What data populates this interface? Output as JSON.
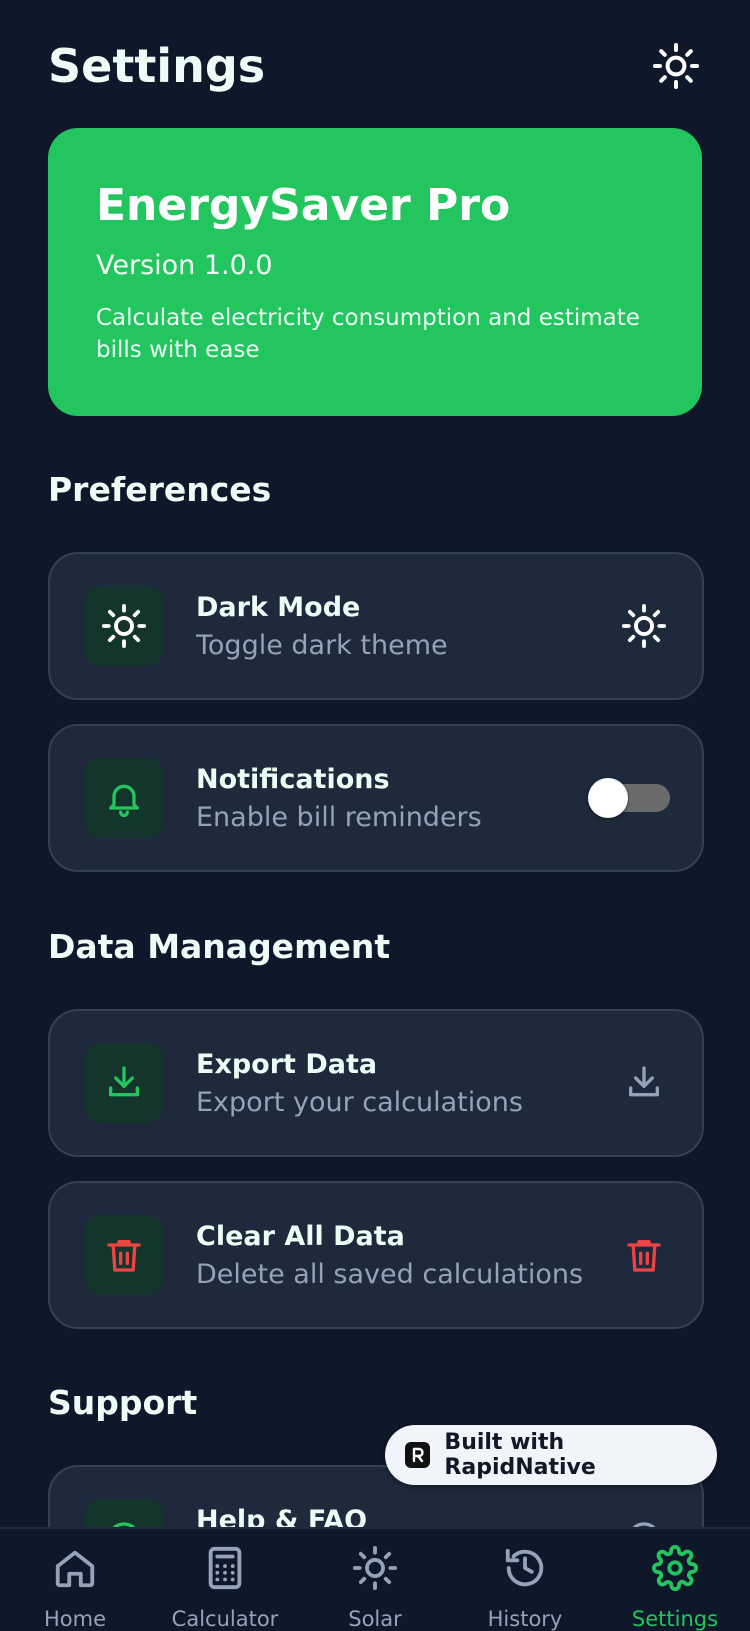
{
  "header": {
    "title": "Settings",
    "theme_icon": "sun-icon"
  },
  "hero": {
    "title": "EnergySaver Pro",
    "version": "Version 1.0.0",
    "description": "Calculate electricity consumption and estimate bills with ease"
  },
  "sections": {
    "preferences": "Preferences",
    "data_management": "Data Management",
    "support": "Support"
  },
  "preferences": {
    "dark_mode": {
      "title": "Dark Mode",
      "subtitle": "Toggle dark theme",
      "icon": "sun-icon"
    },
    "notifications": {
      "title": "Notifications",
      "subtitle": "Enable bill reminders",
      "icon": "bell-icon",
      "enabled": false
    }
  },
  "data_management": {
    "export": {
      "title": "Export Data",
      "subtitle": "Export your calculations",
      "icon": "download-icon"
    },
    "clear": {
      "title": "Clear All Data",
      "subtitle": "Delete all saved calculations",
      "icon": "trash-icon"
    }
  },
  "support": {
    "help": {
      "title": "Help & FAQ",
      "icon": "help-icon"
    }
  },
  "badge": {
    "text": "Built with RapidNative"
  },
  "tabs": [
    {
      "label": "Home",
      "icon": "home-icon",
      "active": false
    },
    {
      "label": "Calculator",
      "icon": "calculator-icon",
      "active": false
    },
    {
      "label": "Solar",
      "icon": "sun-icon",
      "active": false
    },
    {
      "label": "History",
      "icon": "history-icon",
      "active": false
    },
    {
      "label": "Settings",
      "icon": "gear-icon",
      "active": true
    }
  ],
  "colors": {
    "background": "#0f172a",
    "card": "#1e293b",
    "accent": "#22c55e",
    "danger": "#ef4444",
    "muted": "#94a3b8"
  }
}
